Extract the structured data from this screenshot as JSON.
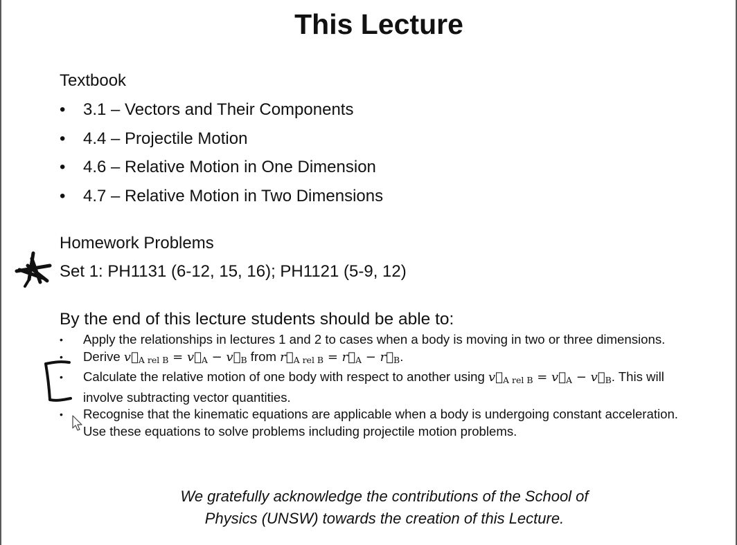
{
  "title": "This Lecture",
  "textbook": {
    "heading": "Textbook",
    "items": [
      "3.1 – Vectors and Their Components",
      "4.4 – Projectile Motion",
      "4.6 – Relative Motion in One Dimension",
      "4.7 – Relative Motion in Two Dimensions"
    ]
  },
  "homework": {
    "heading": "Homework Problems",
    "set": "Set 1:  PH1131 (6-12, 15, 16); PH1121 (5-9, 12)"
  },
  "outcomes": {
    "heading": "By the end of this lecture students should be able to:",
    "bullet": "•",
    "item1": "Apply the relationships in lectures 1 and 2 to cases when a body is moving in two or three dimensions.",
    "item2": {
      "prefix": "Derive ",
      "eq_a": "v⃗",
      "eq_a_sub": "A rel B",
      "eq_b": " = v⃗",
      "eq_b_sub": "A",
      "eq_c": " − v⃗",
      "eq_c_sub": "B",
      "middle": " from ",
      "eq_d": "r⃗",
      "eq_d_sub": "A rel B",
      "eq_e": " = r⃗",
      "eq_e_sub": "A",
      "eq_f": " − r⃗",
      "eq_f_sub": "B",
      "suffix": "."
    },
    "item3": {
      "prefix": "Calculate the relative motion of one body with respect to another using ",
      "eq_a": "v⃗",
      "eq_a_sub": "A rel B",
      "eq_b": " = v⃗",
      "eq_b_sub": "A",
      "eq_c": " − v⃗",
      "eq_c_sub": "B",
      "suffix": ". This will involve subtracting vector quantities."
    },
    "item4": "Recognise that the kinematic equations are applicable when a body is undergoing constant acceleration. Use these equations to solve problems including projectile motion problems."
  },
  "acknowledgement": {
    "line1": "We gratefully acknowledge the contributions of the School of",
    "line2": "Physics (UNSW) towards the creation of this Lecture."
  },
  "colors": {
    "text": "#111111",
    "ink": "#111111",
    "background": "#ffffff"
  },
  "icons": [
    "star-annotation-icon",
    "bracket-annotation-icon",
    "mouse-cursor-icon"
  ]
}
